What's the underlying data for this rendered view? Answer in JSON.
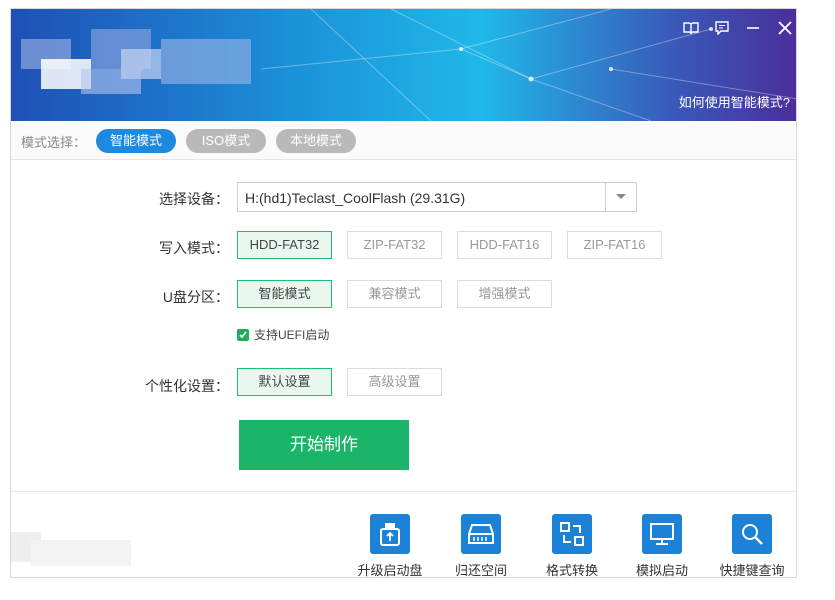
{
  "banner": {
    "help_link": "如何使用智能模式?"
  },
  "modebar": {
    "label": "模式选择：",
    "modes": [
      {
        "label": "智能模式",
        "active": true
      },
      {
        "label": "ISO模式",
        "active": false
      },
      {
        "label": "本地模式",
        "active": false
      }
    ]
  },
  "form": {
    "device_label": "选择设备：",
    "device_value": "H:(hd1)Teclast_CoolFlash (29.31G)",
    "write_label": "写入模式：",
    "write_options": [
      "HDD-FAT32",
      "ZIP-FAT32",
      "HDD-FAT16",
      "ZIP-FAT16"
    ],
    "partition_label": "U盘分区：",
    "partition_options": [
      "智能模式",
      "兼容模式",
      "增强模式"
    ],
    "uefi_label": "支持UEFI启动",
    "custom_label": "个性化设置：",
    "custom_options": [
      "默认设置",
      "高级设置"
    ],
    "start_label": "开始制作"
  },
  "tools": [
    {
      "label": "升级启动盘",
      "icon": "upgrade-disk-icon"
    },
    {
      "label": "归还空间",
      "icon": "restore-space-icon"
    },
    {
      "label": "格式转换",
      "icon": "format-convert-icon"
    },
    {
      "label": "模拟启动",
      "icon": "simulate-boot-icon"
    },
    {
      "label": "快捷键查询",
      "icon": "hotkey-search-icon"
    }
  ],
  "colors": {
    "accent": "#1c8ae0",
    "green": "#1bb56a",
    "tool_blue": "#1c82d8"
  }
}
